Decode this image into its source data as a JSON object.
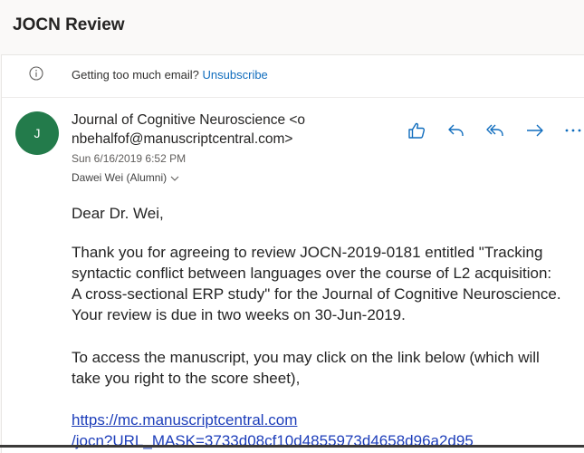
{
  "header": {
    "subject": "JOCN Review"
  },
  "notice": {
    "text": "Getting too much email?",
    "link_label": "Unsubscribe",
    "icon": "info-icon"
  },
  "message": {
    "avatar_initial": "J",
    "avatar_color": "#237b4b",
    "sender_line1": "Journal of Cognitive Neuroscience <o",
    "sender_line2": "nbehalfof@manuscriptcentral.com>",
    "date": "Sun 6/16/2019 6:52 PM",
    "recipient": "Dawei Wei (Alumni)",
    "actions": [
      {
        "name": "like-icon"
      },
      {
        "name": "reply-icon"
      },
      {
        "name": "reply-all-icon"
      },
      {
        "name": "forward-icon"
      },
      {
        "name": "more-icon"
      }
    ]
  },
  "body": {
    "greeting": "Dear Dr. Wei,",
    "para1_lines": [
      "Thank you for agreeing to review JOCN-2019-0181 entitled \"Tracking",
      "syntactic conflict between languages over the course of L2 acquisition:",
      "A cross-sectional ERP study\" for the Journal of Cognitive Neuroscience.",
      "Your review is due in two weeks on 30-Jun-2019."
    ],
    "para2_lines": [
      "To access the manuscript, you may click on the link below (which will",
      "take you right to the score sheet),"
    ],
    "link_lines": [
      "https://mc.manuscriptcentral.com",
      "/jocn?URL_MASK=3733d08cf10d4855973d4658d96a2d95"
    ]
  },
  "colors": {
    "accent": "#0f6cbd",
    "link": "#1d3eba",
    "avatar": "#237b4b"
  }
}
